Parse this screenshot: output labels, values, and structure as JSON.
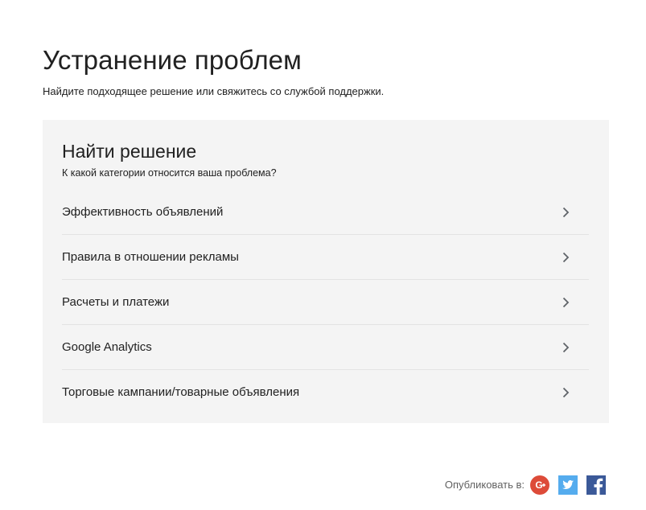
{
  "header": {
    "title": "Устранение проблем",
    "subtitle": "Найдите подходящее решение или свяжитесь со службой поддержки."
  },
  "finder": {
    "title": "Найти решение",
    "question": "К какой категории относится ваша проблема?",
    "options": [
      {
        "label": "Эффективность объявлений",
        "icon": "chevron-right-icon"
      },
      {
        "label": "Правила в отношении рекламы",
        "icon": "chevron-right-icon"
      },
      {
        "label": "Расчеты и платежи",
        "icon": "chevron-right-icon"
      },
      {
        "label": "Google Analytics",
        "icon": "chevron-right-icon"
      },
      {
        "label": "Торговые кампании/товарные объявления",
        "icon": "chevron-right-icon"
      }
    ]
  },
  "share": {
    "label": "Опубликовать в:",
    "networks": [
      {
        "name": "google-plus",
        "icon": "google-plus-icon",
        "color": "#dd4b39"
      },
      {
        "name": "twitter",
        "icon": "twitter-icon",
        "color": "#55acee"
      },
      {
        "name": "facebook",
        "icon": "facebook-icon",
        "color": "#3b5998"
      }
    ]
  },
  "colors": {
    "panel_background": "#f4f4f4",
    "divider": "#e3e3e3",
    "text": "#212121",
    "muted_text": "#616161"
  }
}
